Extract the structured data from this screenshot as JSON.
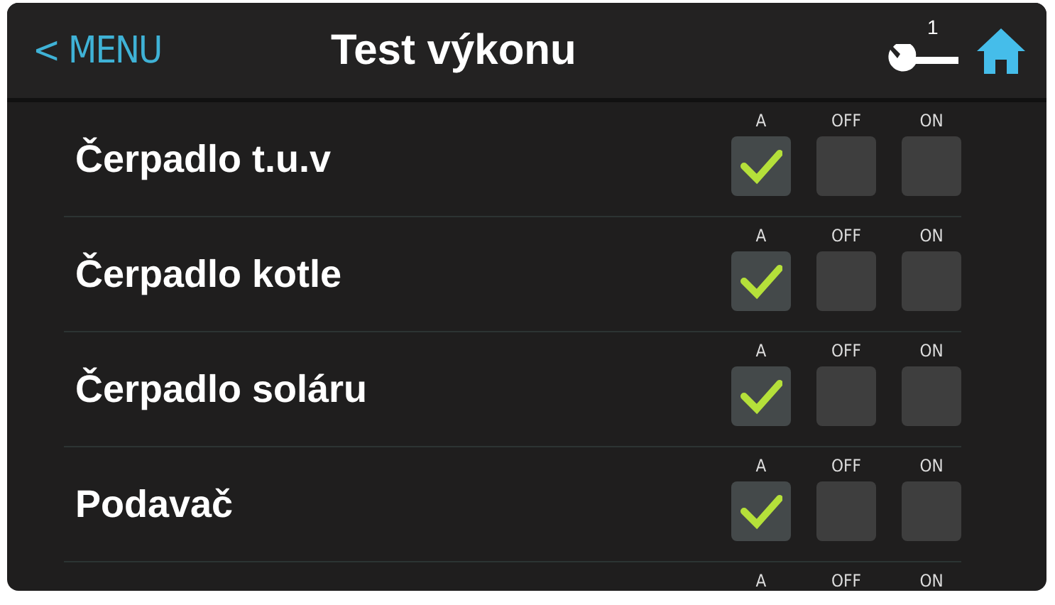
{
  "header": {
    "back_link": "< MENU",
    "title": "Test výkonu",
    "service_badge": "1"
  },
  "rows": [
    {
      "label": "Čerpadlo t.u.v",
      "options": [
        {
          "label": "A",
          "selected": true
        },
        {
          "label": "OFF",
          "selected": false
        },
        {
          "label": "ON",
          "selected": false
        }
      ]
    },
    {
      "label": "Čerpadlo kotle",
      "options": [
        {
          "label": "A",
          "selected": true
        },
        {
          "label": "OFF",
          "selected": false
        },
        {
          "label": "ON",
          "selected": false
        }
      ]
    },
    {
      "label": "Čerpadlo soláru",
      "options": [
        {
          "label": "A",
          "selected": true
        },
        {
          "label": "OFF",
          "selected": false
        },
        {
          "label": "ON",
          "selected": false
        }
      ]
    },
    {
      "label": "Podavač",
      "options": [
        {
          "label": "A",
          "selected": true
        },
        {
          "label": "OFF",
          "selected": false
        },
        {
          "label": "ON",
          "selected": false
        }
      ]
    },
    {
      "options": [
        {
          "label": "A"
        },
        {
          "label": "OFF"
        },
        {
          "label": "ON"
        }
      ]
    }
  ]
}
